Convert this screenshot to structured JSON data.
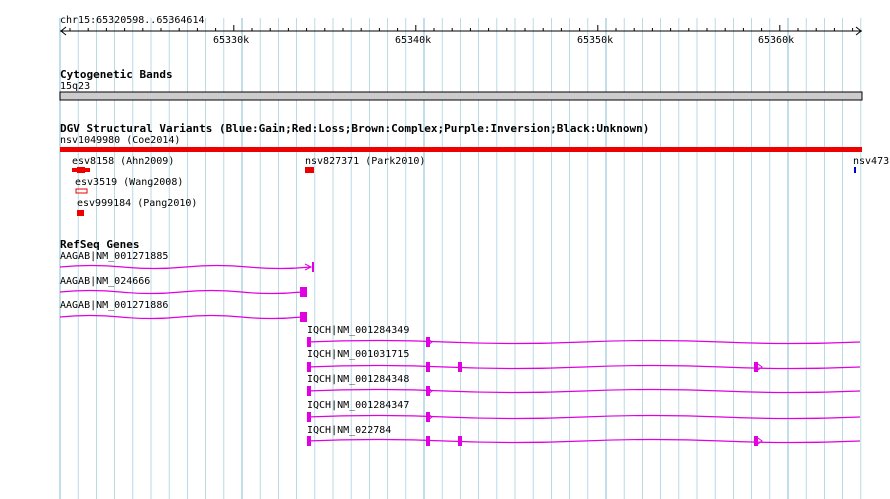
{
  "locus": "chr15:65320598..65364614",
  "ruler": {
    "ticks": [
      "65330k",
      "65340k",
      "65350k",
      "65360k"
    ]
  },
  "tracks": {
    "cytoband": {
      "title": "Cytogenetic Bands",
      "band": "15q23"
    },
    "dgv": {
      "title": "DGV Structural Variants (Blue:Gain;Red:Loss;Brown:Complex;Purple:Inversion;Black:Unknown)",
      "features": [
        {
          "label": "nsv1049980 (Coe2014)",
          "type": "Loss"
        },
        {
          "label": "esv8158 (Ahn2009)",
          "type": "Loss"
        },
        {
          "label": "nsv827371 (Park2010)",
          "type": "Loss"
        },
        {
          "label": "nsv473",
          "type": "Gain"
        },
        {
          "label": "esv3519 (Wang2008)",
          "type": "Loss"
        },
        {
          "label": "esv999184 (Pang2010)",
          "type": "Loss"
        }
      ]
    },
    "refseq": {
      "title": "RefSeq Genes",
      "transcripts": [
        {
          "label": "AAGAB|NM_001271885"
        },
        {
          "label": "AAGAB|NM_024666"
        },
        {
          "label": "AAGAB|NM_001271886"
        },
        {
          "label": "IQCH|NM_001284349"
        },
        {
          "label": "IQCH|NM_001031715"
        },
        {
          "label": "IQCH|NM_001284348"
        },
        {
          "label": "IQCH|NM_001284347"
        },
        {
          "label": "IQCH|NM_022784"
        }
      ]
    }
  },
  "colors": {
    "grid": "#a8d0e0",
    "loss": "#ee0000",
    "gain": "#0000cc",
    "gene": "#e000e0",
    "cytoband": "#cccccc",
    "scale": "#000000"
  }
}
